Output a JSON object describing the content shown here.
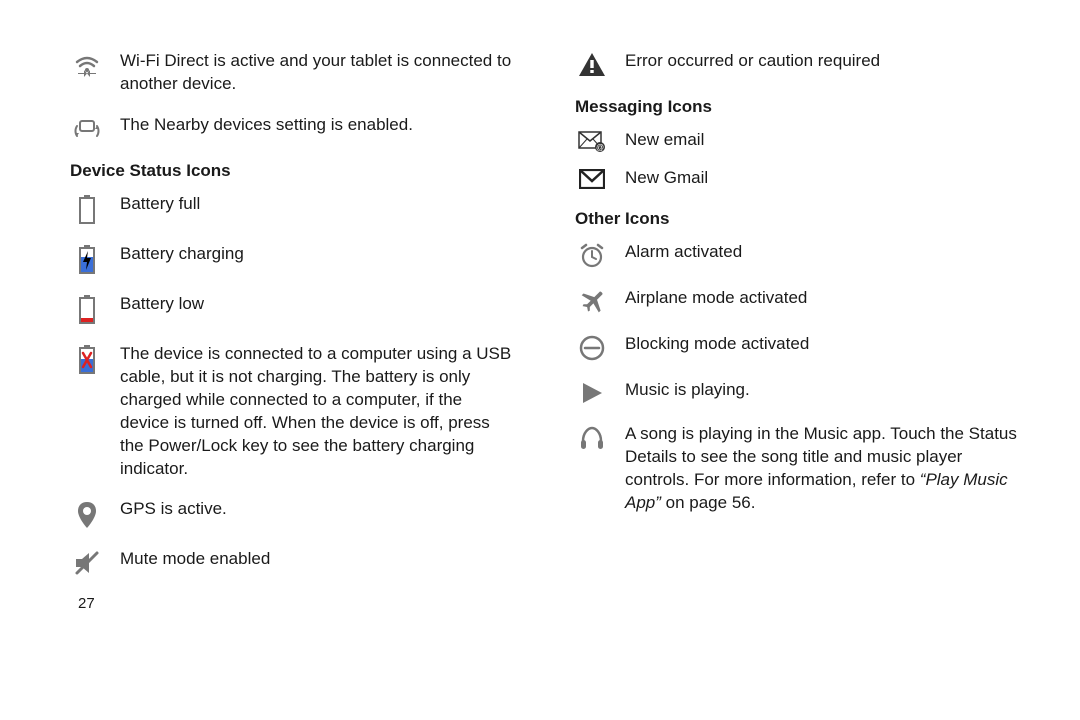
{
  "left": {
    "intro": [
      {
        "icon": "wifi-direct-icon",
        "text": "Wi-Fi Direct is active and your tablet is connected to another device."
      },
      {
        "icon": "nearby-devices-icon",
        "text": "The Nearby devices setting is enabled."
      }
    ],
    "deviceStatus": {
      "heading": "Device Status Icons",
      "items": [
        {
          "icon": "battery-full-icon",
          "text": "Battery full"
        },
        {
          "icon": "battery-charging-icon",
          "text": "Battery charging"
        },
        {
          "icon": "battery-low-icon",
          "text": "Battery low"
        },
        {
          "icon": "battery-usb-not-charging-icon",
          "text": "The device is connected to a computer using a USB cable, but it is not charging. The battery is only charged while connected to a computer, if the device is turned off. When the device is off, press the Power/Lock key to see the battery charging indicator."
        },
        {
          "icon": "gps-pin-icon",
          "text": "GPS is active."
        },
        {
          "icon": "mute-mode-icon",
          "text": "Mute mode enabled"
        }
      ]
    },
    "pageNumber": "27"
  },
  "right": {
    "intro": [
      {
        "icon": "caution-triangle-icon",
        "text": "Error occurred or caution required"
      }
    ],
    "messaging": {
      "heading": "Messaging Icons",
      "items": [
        {
          "icon": "new-email-icon",
          "text": "New email"
        },
        {
          "icon": "new-gmail-icon",
          "text": "New Gmail"
        }
      ]
    },
    "other": {
      "heading": "Other Icons",
      "items": [
        {
          "icon": "alarm-clock-icon",
          "text": "Alarm activated"
        },
        {
          "icon": "airplane-icon",
          "text": "Airplane mode activated"
        },
        {
          "icon": "blocking-mode-icon",
          "text": "Blocking mode activated"
        },
        {
          "icon": "play-triangle-icon",
          "text": "Music is playing."
        },
        {
          "icon": "headphones-icon",
          "text": "A song is playing in the Music app. Touch the Status Details to see the song title and music player controls. For more information, refer to ",
          "tail_italic": "“Play Music App”",
          "tail_plain": " on page 56."
        }
      ]
    }
  }
}
